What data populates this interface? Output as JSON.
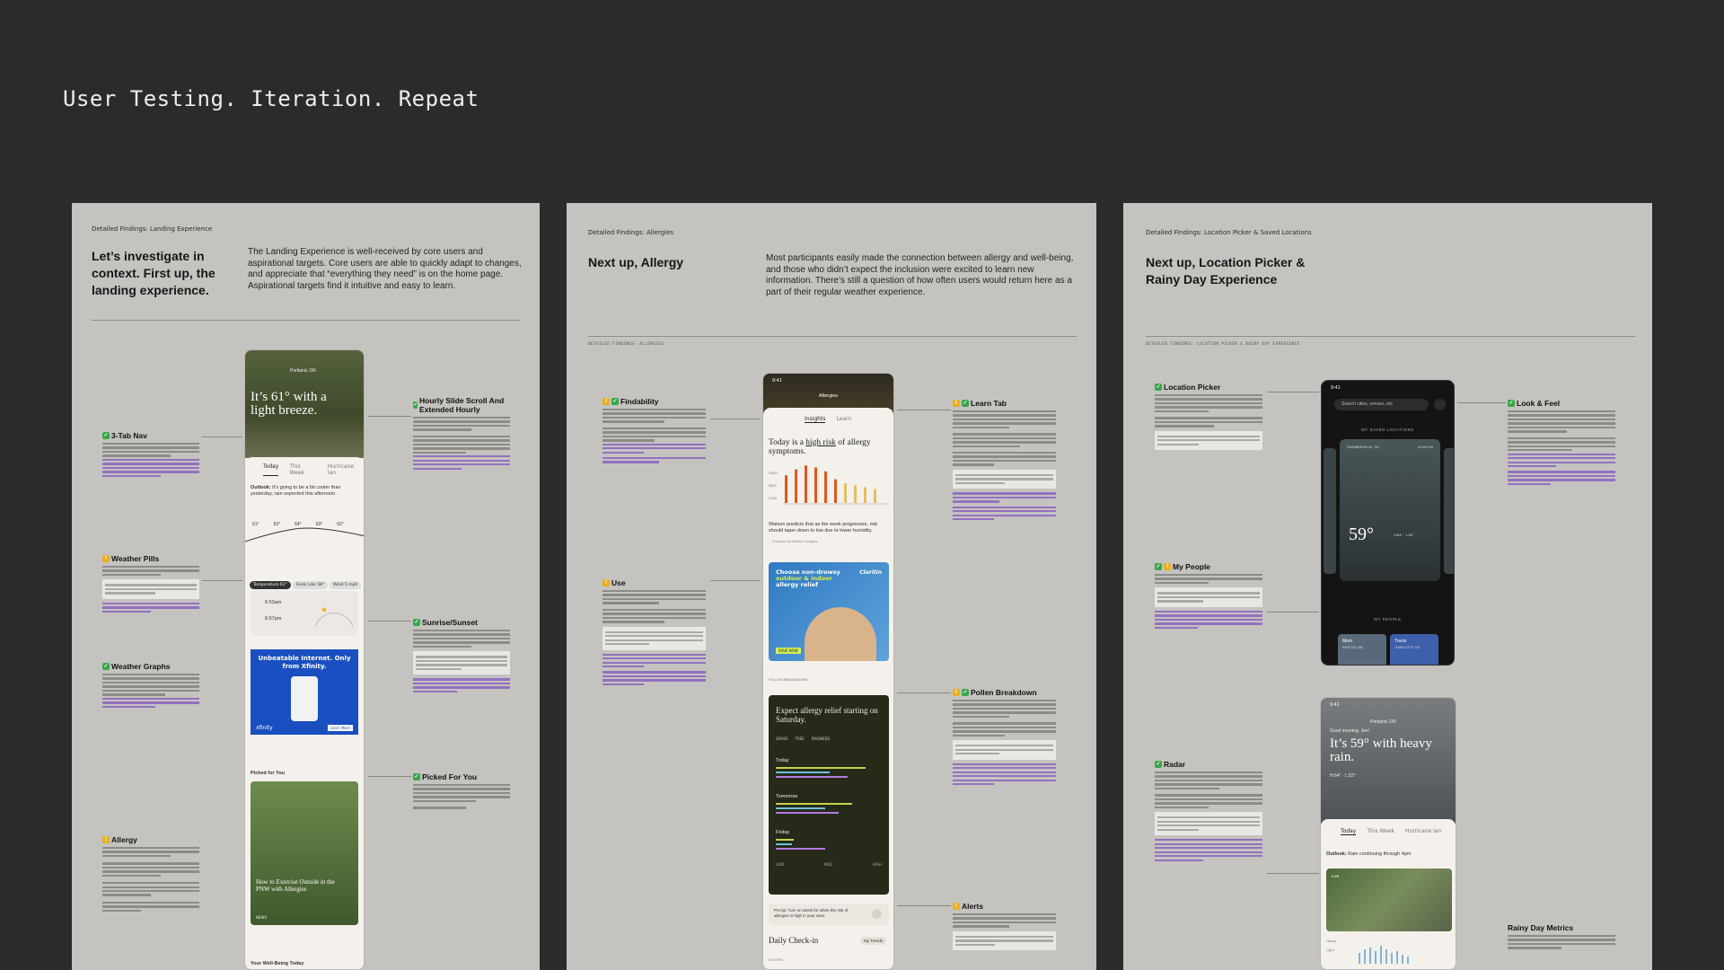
{
  "headline": "User Testing. Iteration. Repeat",
  "board1": {
    "crumb": "Detailed Findings: Landing Experience",
    "title": "Let’s investigate in context. First up, the landing experience.",
    "desc": "The Landing Experience is well-received by core users and aspirational targets. Core users are able to quickly adapt to changes, and appreciate that “everything they need” is on the home page. Aspirational targets find it intuitive and easy to learn.",
    "phone": {
      "city": "Portland, OR",
      "headline": "It’s 61° with a light breeze.",
      "tabs": [
        "Today",
        "This Week",
        "Hurricane Ian"
      ],
      "outlook_label": "Outlook:",
      "outlook": "It’s going to be a bit cooler than yesterday, rain expected this afternoon.",
      "temps": [
        "61°",
        "63°",
        "64°",
        "63°",
        "62°"
      ],
      "pills": [
        "Temperature 61°",
        "Feels Like 58°",
        "Wind 5 mph"
      ],
      "sunrise": "6:53am",
      "sunset": "6:57pm",
      "ad_title": "Unbeatable Internet. Only from Xfinity.",
      "ad_brand": "xfinity",
      "ad_cta": "Learn More",
      "picked_label": "Picked for You",
      "article": "How to Exercise Outside in the PNW with Allergies",
      "article_src": "NEWS",
      "wellbeing": "Your Well-Being Today"
    },
    "notes": {
      "nav": "3-Tab Nav",
      "pills": "Weather Pills",
      "graphs": "Weather Graphs",
      "allergy": "Allergy",
      "hourly": "Hourly Slide Scroll And Extended Hourly",
      "sun": "Sunrise/Sunset",
      "picked": "Picked For You"
    }
  },
  "board2": {
    "crumb": "Detailed Findings: Allergies",
    "title": "Next up, Allergy",
    "desc": "Most participants easily made the connection between allergy and well-being, and those who didn’t expect the inclusion were excited to learn new information. There’s still a question of how often users would return here as a part of their regular weather experience.",
    "mono": "DETAILED FINDINGS: ALLERGIES",
    "phone": {
      "time": "9:41",
      "screen": "Allergies",
      "tabs": [
        "Insights",
        "Learn"
      ],
      "headline_a": "Today is a ",
      "headline_link": "high risk",
      "headline_b": " of allergy symptoms.",
      "levels": [
        "HIGH",
        "MED",
        "LOW"
      ],
      "bars": [
        0.7,
        0.85,
        0.95,
        0.9,
        0.8,
        0.6,
        0.5,
        0.45,
        0.4,
        0.35
      ],
      "forecast": "Watson predicts that as the week progresses, risk should taper down to low due to lower humidity.",
      "powered": "Powered by Watson Insights",
      "ad_line1": "Choose non-drowsy",
      "ad_line2": "outdoor & indoor",
      "ad_line3": "allergy relief",
      "ad_brand": "Claritin",
      "ad_cta": "SAVE NOW",
      "breakdown_label": "POLLEN BREAKDOWN",
      "relief": "Expect allergy relief starting on Saturday.",
      "legend": [
        "GRASS",
        "TREE",
        "RAGWEED"
      ],
      "days": [
        "Today",
        "Tomorrow",
        "Friday"
      ],
      "axis": [
        "LOW",
        "MED",
        "HIGH"
      ],
      "tip": "Pro tip: Turn on alerts for when the risk of allergies is high in your area.",
      "checkin": "Daily Check-in",
      "trends": "My Trends",
      "severe": "SEVERE"
    },
    "notes": {
      "find": "Findability",
      "use": "Use",
      "learn": "Learn Tab",
      "pollen": "Pollen Breakdown",
      "alerts": "Alerts"
    }
  },
  "board3": {
    "crumb": "Detailed Findings: Location Picker & Saved Locations",
    "title": "Next up, Location Picker & Rainy Day Experience",
    "mono": "DETAILED FINDINGS: LOCATION PICKER & RAINY DAY EXPERIENCE",
    "phoneA": {
      "time": "9:41",
      "search": "Search cities, venues, etc",
      "saved": "MY SAVED LOCATIONS",
      "city": "SUMMERVILLE, SC",
      "clock": "12:45 PM",
      "temp": "59°",
      "hilo": "H:64° · L:52°",
      "people": "MY PEOPLE",
      "p1": "Mom",
      "p1city": "SEATTLE, WA",
      "p2": "Travis",
      "p2city": "CHARLOTTE, NC"
    },
    "phoneB": {
      "time": "9:41",
      "greeting": "Good morning, Jen!",
      "city": "Portland, OR",
      "headline": "It’s 59° with heavy rain.",
      "hilo": "H:64° · L:52°",
      "tabs": [
        "Today",
        "This Week",
        "Hurricane Ian"
      ],
      "outlook_label": "Outlook:",
      "outlook": "Rain continuing through 4pm",
      "radar_label": "Live",
      "rain_axis": [
        "Heavy",
        "Light"
      ]
    },
    "notes": {
      "picker": "Location Picker",
      "people": "My People",
      "radar": "Radar",
      "look": "Look & Feel",
      "rainy": "Rainy Day Metrics"
    }
  },
  "colors": {
    "bg": "#2b2b2b",
    "board": "#c5c3bf",
    "check": "#3aa64a",
    "warn": "#e8b020",
    "quote": "#7e4fc0",
    "allergy_bar": "#e2571b"
  }
}
